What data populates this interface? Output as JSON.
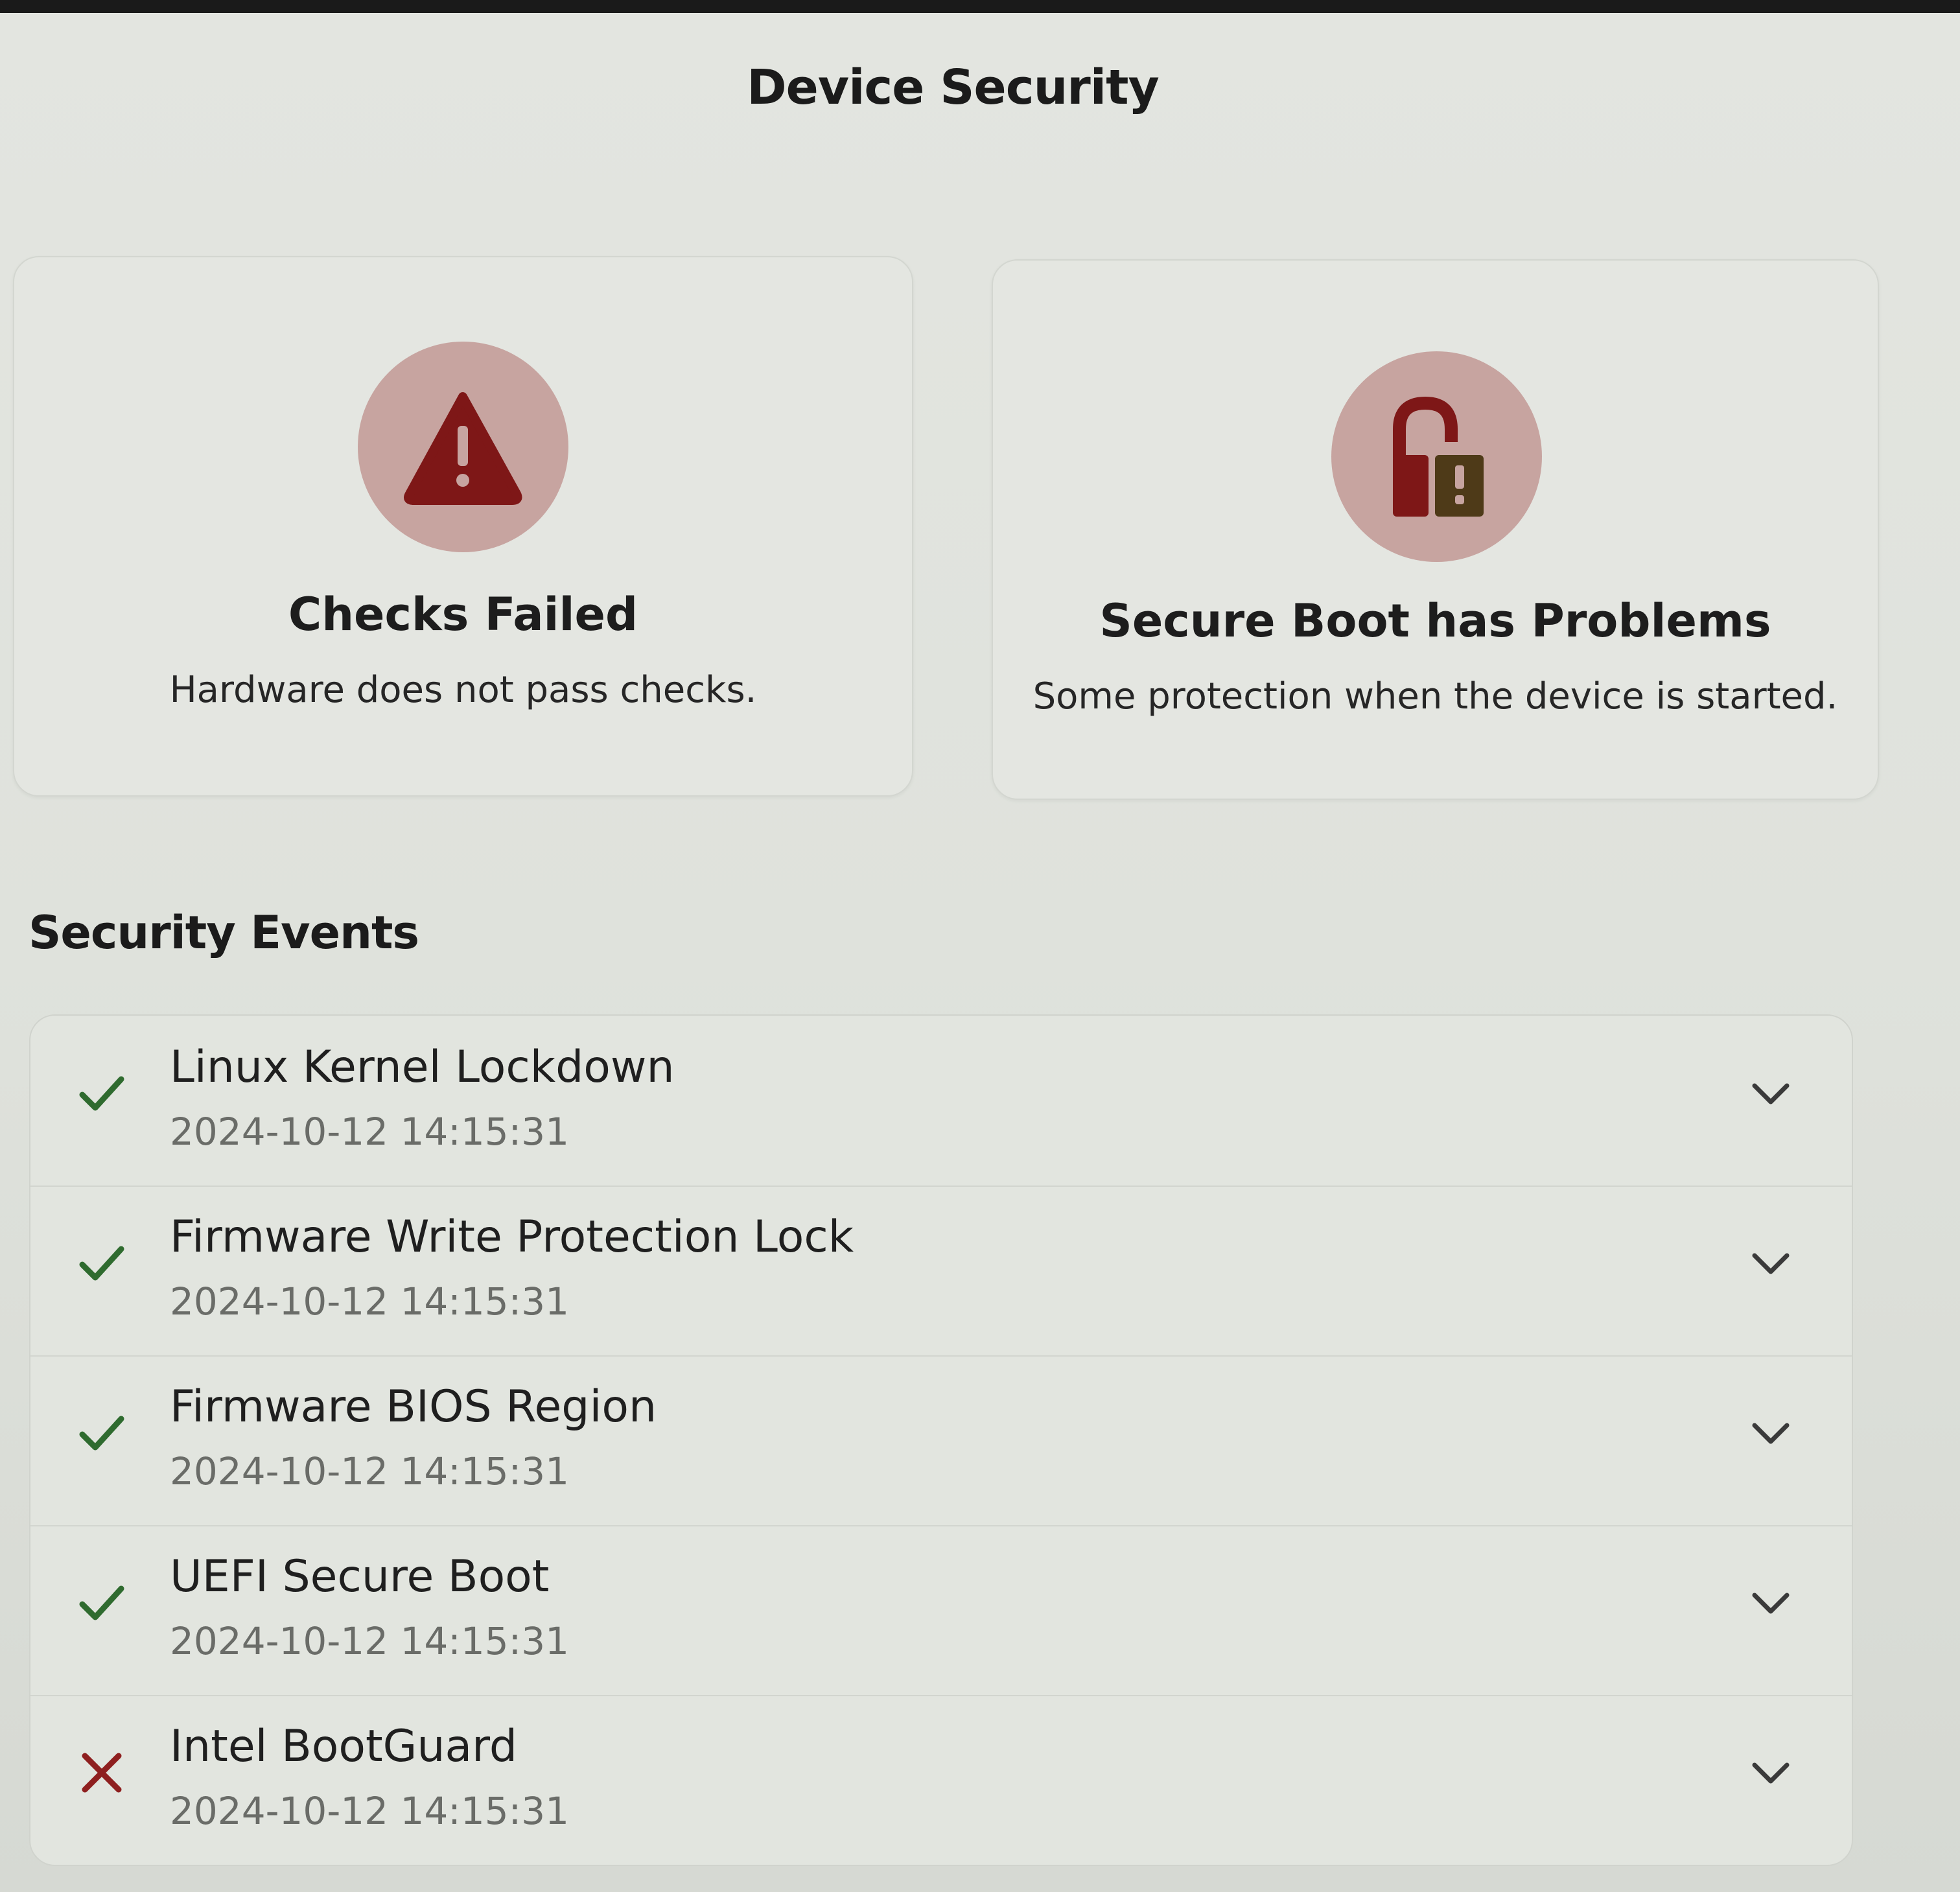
{
  "header": {
    "title": "Device Security"
  },
  "summary_cards": [
    {
      "title": "Checks Failed",
      "subtitle": "Hardware does not pass checks.",
      "icon": "warning-icon"
    },
    {
      "title": "Secure Boot has Problems",
      "subtitle": "Some protection when the device is started.",
      "icon": "unlocked-padlock-icon"
    }
  ],
  "events": {
    "heading": "Security Events",
    "items": [
      {
        "name": "Linux Kernel Lockdown",
        "time": "2024-10-12 14:15:31",
        "status": "pass"
      },
      {
        "name": "Firmware Write Protection Lock",
        "time": "2024-10-12 14:15:31",
        "status": "pass"
      },
      {
        "name": "Firmware BIOS Region",
        "time": "2024-10-12 14:15:31",
        "status": "pass"
      },
      {
        "name": "UEFI Secure Boot",
        "time": "2024-10-12 14:15:31",
        "status": "pass"
      },
      {
        "name": "Intel BootGuard",
        "time": "2024-10-12 14:15:31",
        "status": "fail"
      }
    ]
  },
  "colors": {
    "pass": "#2f6b2f",
    "fail": "#8e1f1f",
    "status_circle": "#c7a4a0",
    "warning_red": "#7e1717"
  }
}
